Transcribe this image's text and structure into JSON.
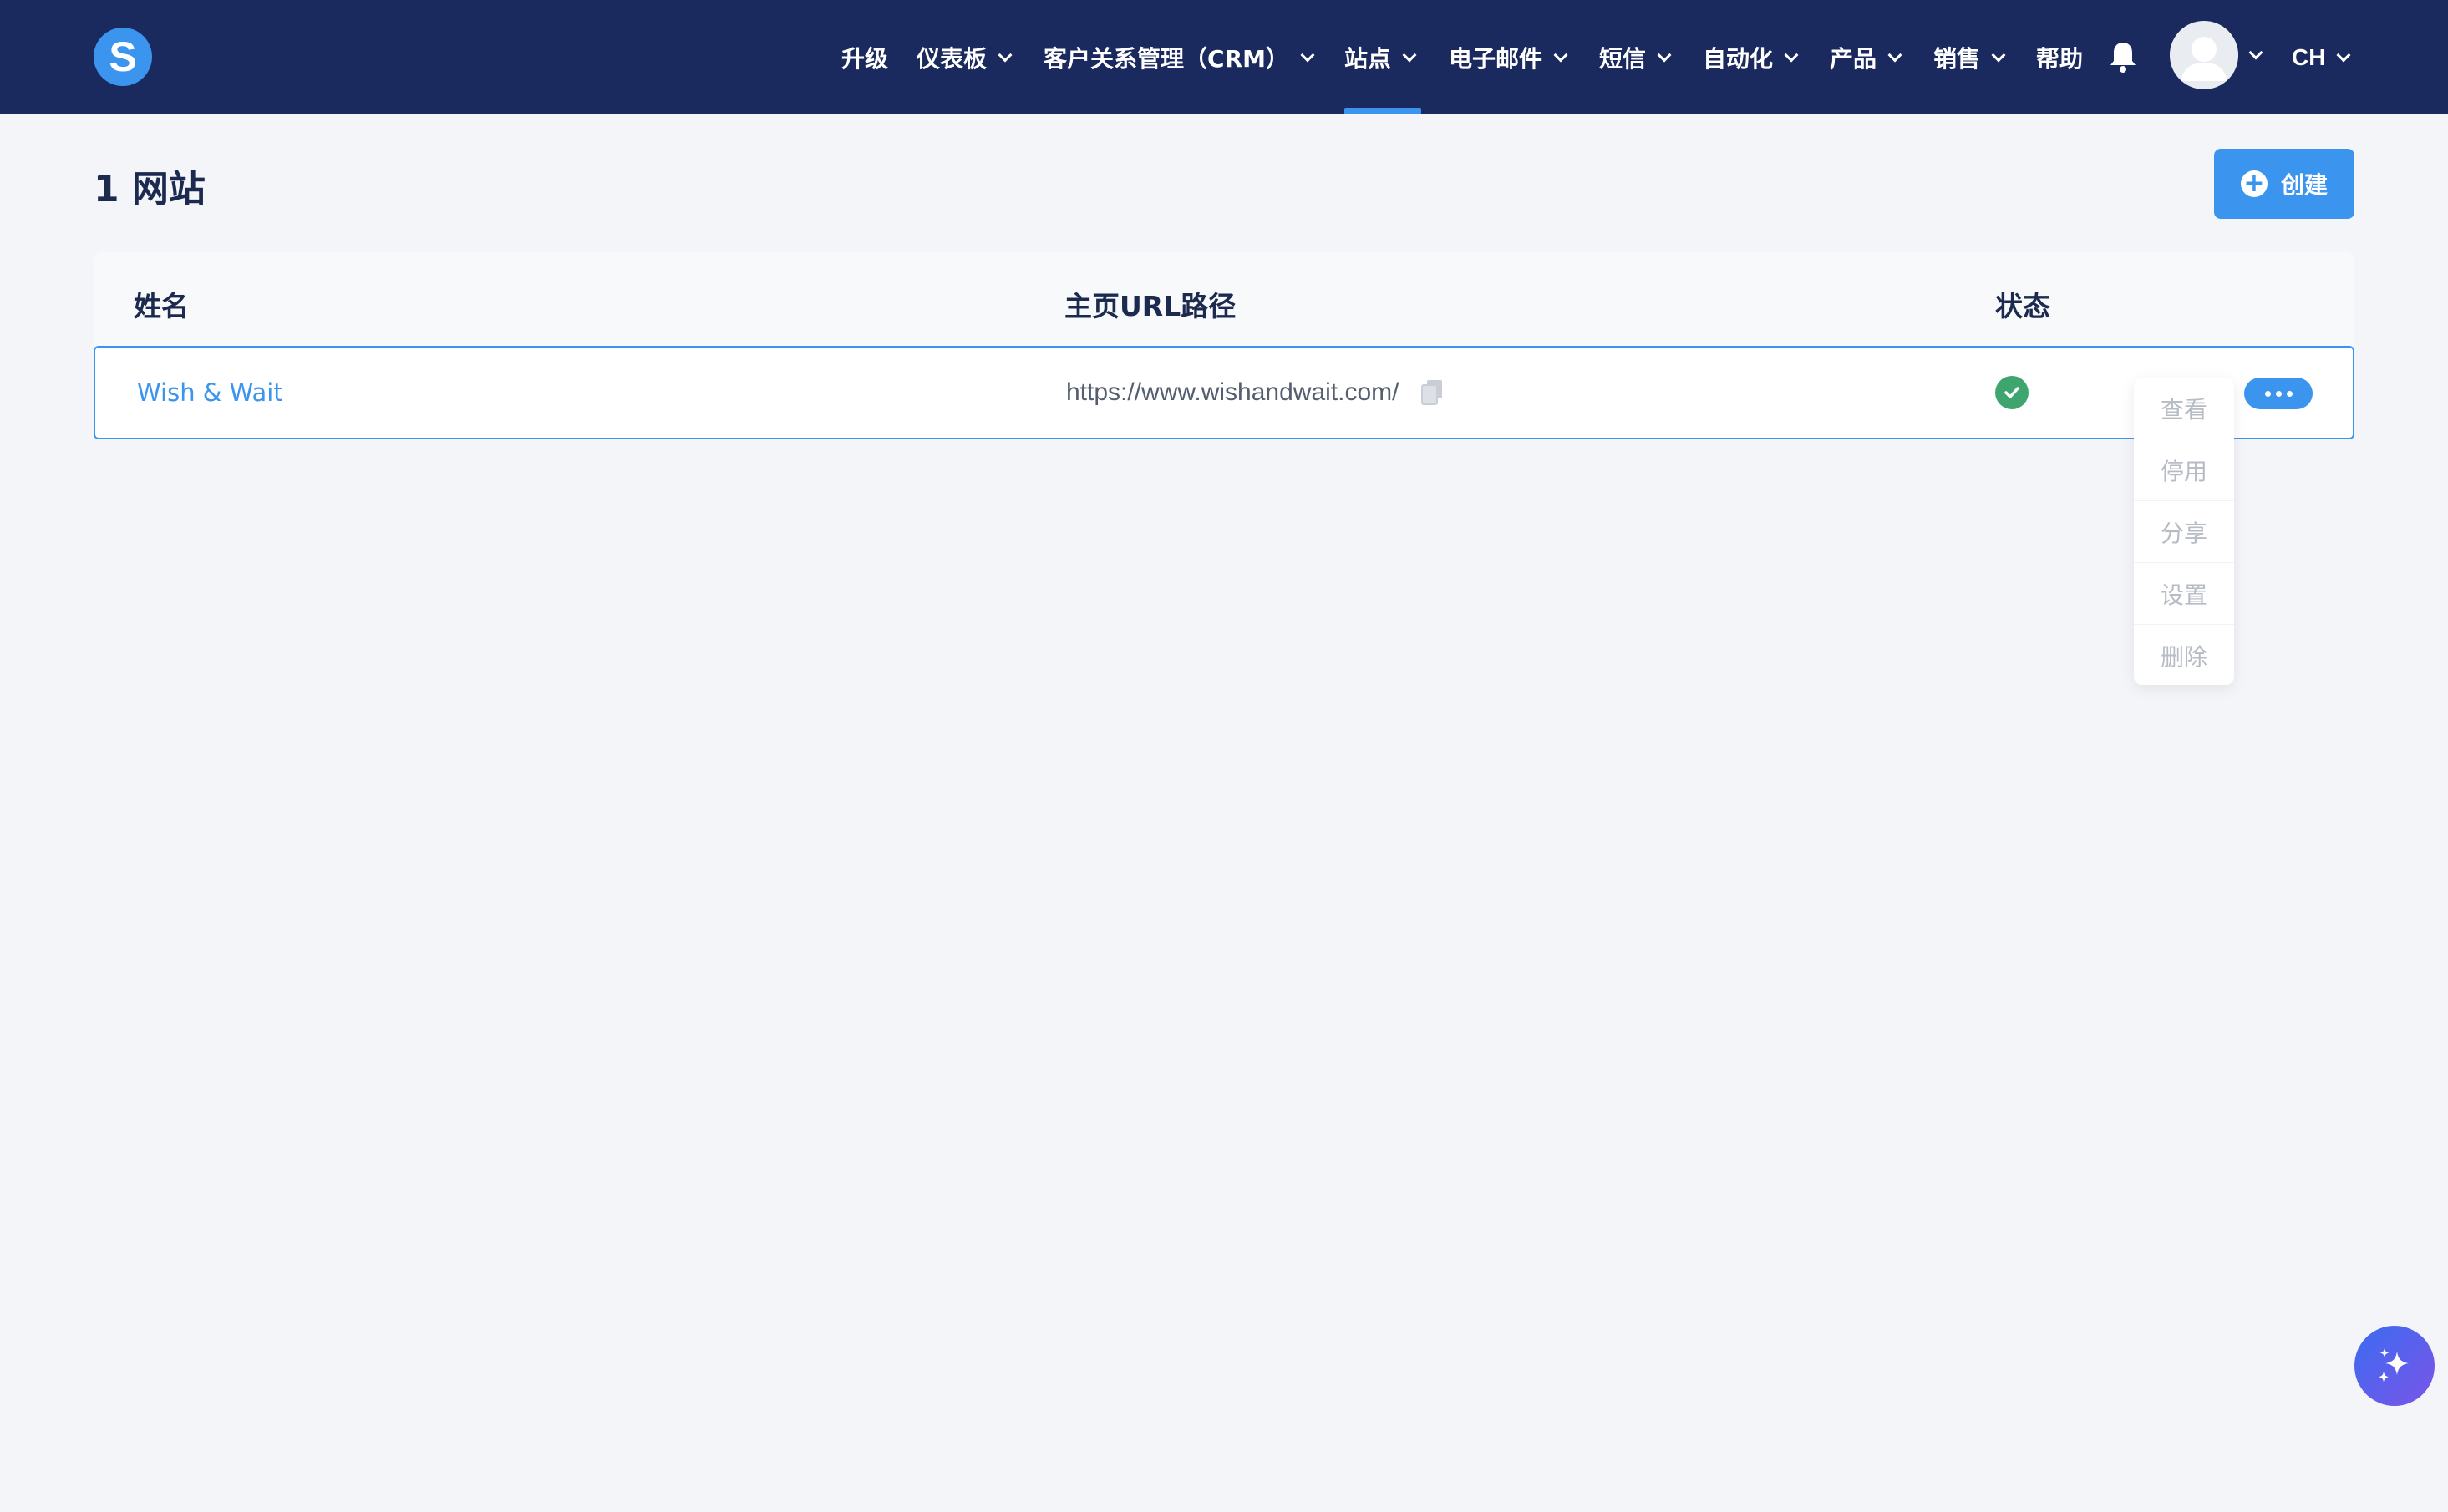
{
  "app": {
    "logo_letter": "S",
    "brand_color": "#1b2a5e",
    "accent_color": "#3b95ee"
  },
  "nav": {
    "items": [
      {
        "label": "升级",
        "has_dropdown": false
      },
      {
        "label": "仪表板",
        "has_dropdown": true
      },
      {
        "label": "客户关系管理（CRM）",
        "has_dropdown": true
      },
      {
        "label": "站点",
        "has_dropdown": true,
        "active": true
      },
      {
        "label": "电子邮件",
        "has_dropdown": true
      },
      {
        "label": "短信",
        "has_dropdown": true
      },
      {
        "label": "自动化",
        "has_dropdown": true
      },
      {
        "label": "产品",
        "has_dropdown": true
      },
      {
        "label": "销售",
        "has_dropdown": true
      },
      {
        "label": "帮助",
        "has_dropdown": false
      }
    ],
    "notification_icon": "bell-icon",
    "avatar_icon": "user-avatar-icon",
    "language": "CH"
  },
  "page": {
    "title": "1 网站",
    "create_button": "创建"
  },
  "table": {
    "columns": [
      "姓名",
      "主页URL路径",
      "状态"
    ],
    "rows": [
      {
        "name": "Wish & Wait",
        "url": "https://www.wishandwait.com/",
        "status": "active",
        "status_color": "#3fa56e"
      }
    ]
  },
  "row_menu": {
    "items": [
      "查看",
      "停用",
      "分享",
      "设置",
      "删除"
    ]
  },
  "fab": {
    "icon": "sparkles-icon"
  }
}
